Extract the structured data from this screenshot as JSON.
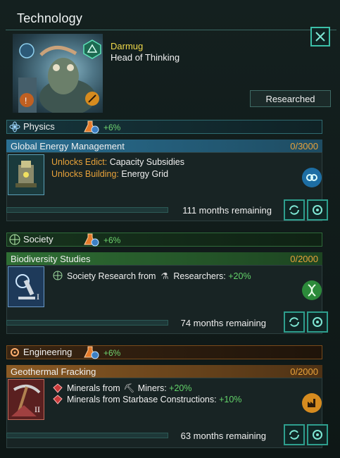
{
  "window": {
    "title": "Technology"
  },
  "head": {
    "name": "Darmug",
    "role": "Head of Thinking",
    "researched_label": "Researched"
  },
  "colors": {
    "physics": "#2d7fa6",
    "society": "#2f8f3e",
    "engineering": "#c67a2a",
    "bonus": "#63d36a",
    "unlock": "#e8a23a"
  },
  "categories": [
    {
      "name": "Physics",
      "bonus": "+6%",
      "tech": {
        "name": "Global Energy Management",
        "progress_text": "0/3000",
        "progress": 0.0,
        "effect1_label": "Unlocks Edict:",
        "effect1_value": "Capacity Subsidies",
        "effect2_label": "Unlocks Building:",
        "effect2_value": "Energy Grid",
        "remaining": "111 months remaining",
        "icon": "physics-tech-icon"
      }
    },
    {
      "name": "Society",
      "bonus": "+6%",
      "tech": {
        "name": "Biodiversity Studies",
        "progress_text": "0/2000",
        "progress": 0.0,
        "effect1_text": "Society Research from",
        "effect1_job": "Researchers:",
        "effect1_value": "+20%",
        "remaining": "74 months remaining",
        "tier": "I",
        "icon": "microscope-icon"
      }
    },
    {
      "name": "Engineering",
      "bonus": "+6%",
      "tech": {
        "name": "Geothermal Fracking",
        "progress_text": "0/2000",
        "progress": 0.0,
        "effect1_text": "Minerals from",
        "effect1_job": "Miners:",
        "effect1_value": "+20%",
        "effect2_text": "Minerals from Starbase Constructions:",
        "effect2_value": "+10%",
        "remaining": "63 months remaining",
        "tier": "II",
        "icon": "pickaxe-icon"
      }
    }
  ]
}
